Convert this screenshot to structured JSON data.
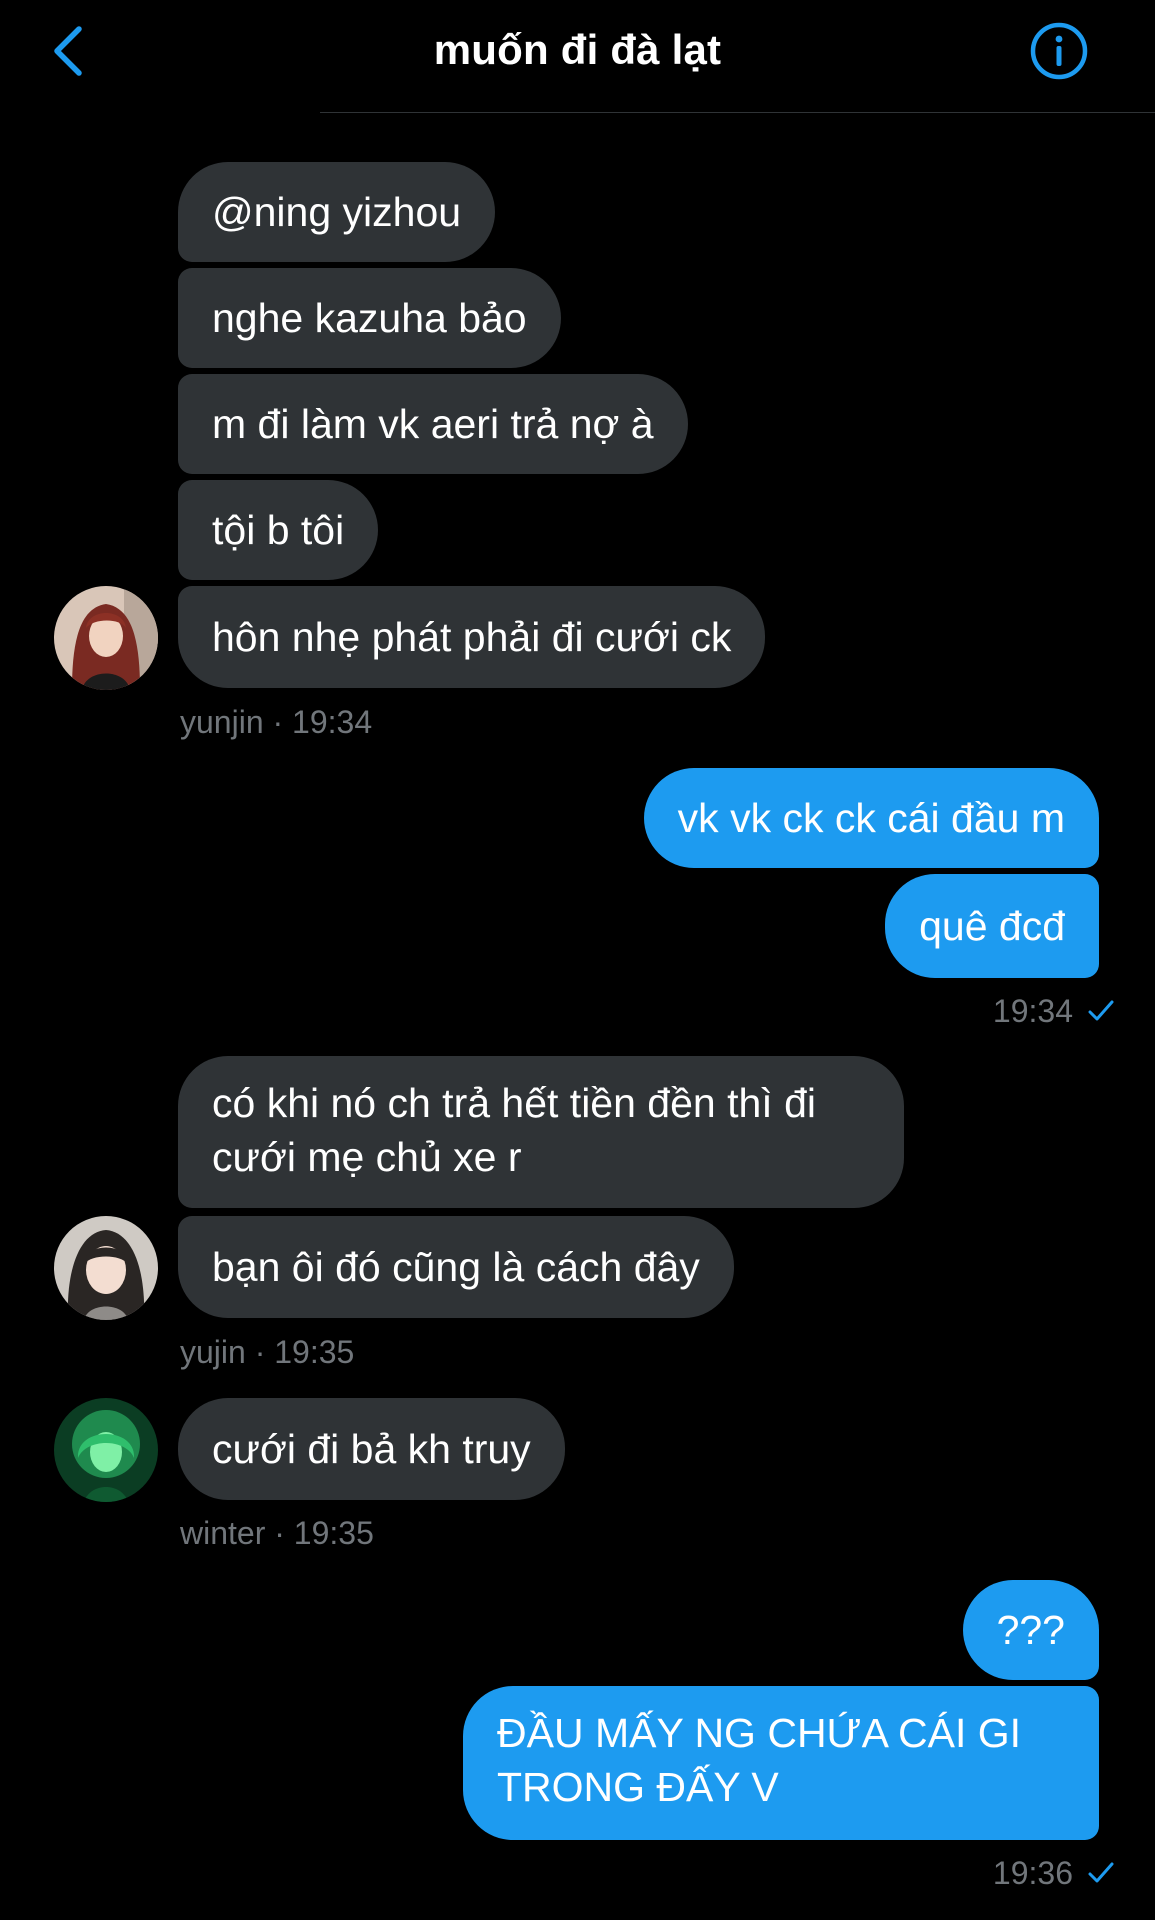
{
  "header": {
    "title": "muốn đi đà lạt",
    "back_icon": "chevron-left-icon",
    "info_icon": "info-icon",
    "accent_color": "#1d9bf0"
  },
  "messages": {
    "m1": "@ning yizhou",
    "m2": "nghe kazuha bảo",
    "m3": "m đi làm vk aeri trả nợ à",
    "m4": "tội b tôi",
    "m5": "hôn nhẹ phát phải đi cưới ck",
    "m5_meta": "yunjin · 19:34",
    "m6": "vk vk ck ck cái đầu m",
    "m7": "quê đcđ",
    "m7_time": "19:34",
    "m8": "có khi nó ch trả hết tiền đền thì đi cưới mẹ chủ xe r",
    "m9": "bạn ôi đó cũng là cách đây",
    "m9_meta": "yujin · 19:35",
    "m10": "cưới đi bả kh truy",
    "m10_meta": "winter · 19:35",
    "m11": "???",
    "m12": "ĐẦU MẤY NG CHỨA CÁI GI TRONG ĐẤY V",
    "m12_time": "19:36"
  },
  "colors": {
    "incoming_bubble": "#2f3336",
    "outgoing_bubble": "#1d9bf0",
    "meta_text": "#71767b",
    "background": "#000000"
  },
  "status_icon": "check-icon"
}
